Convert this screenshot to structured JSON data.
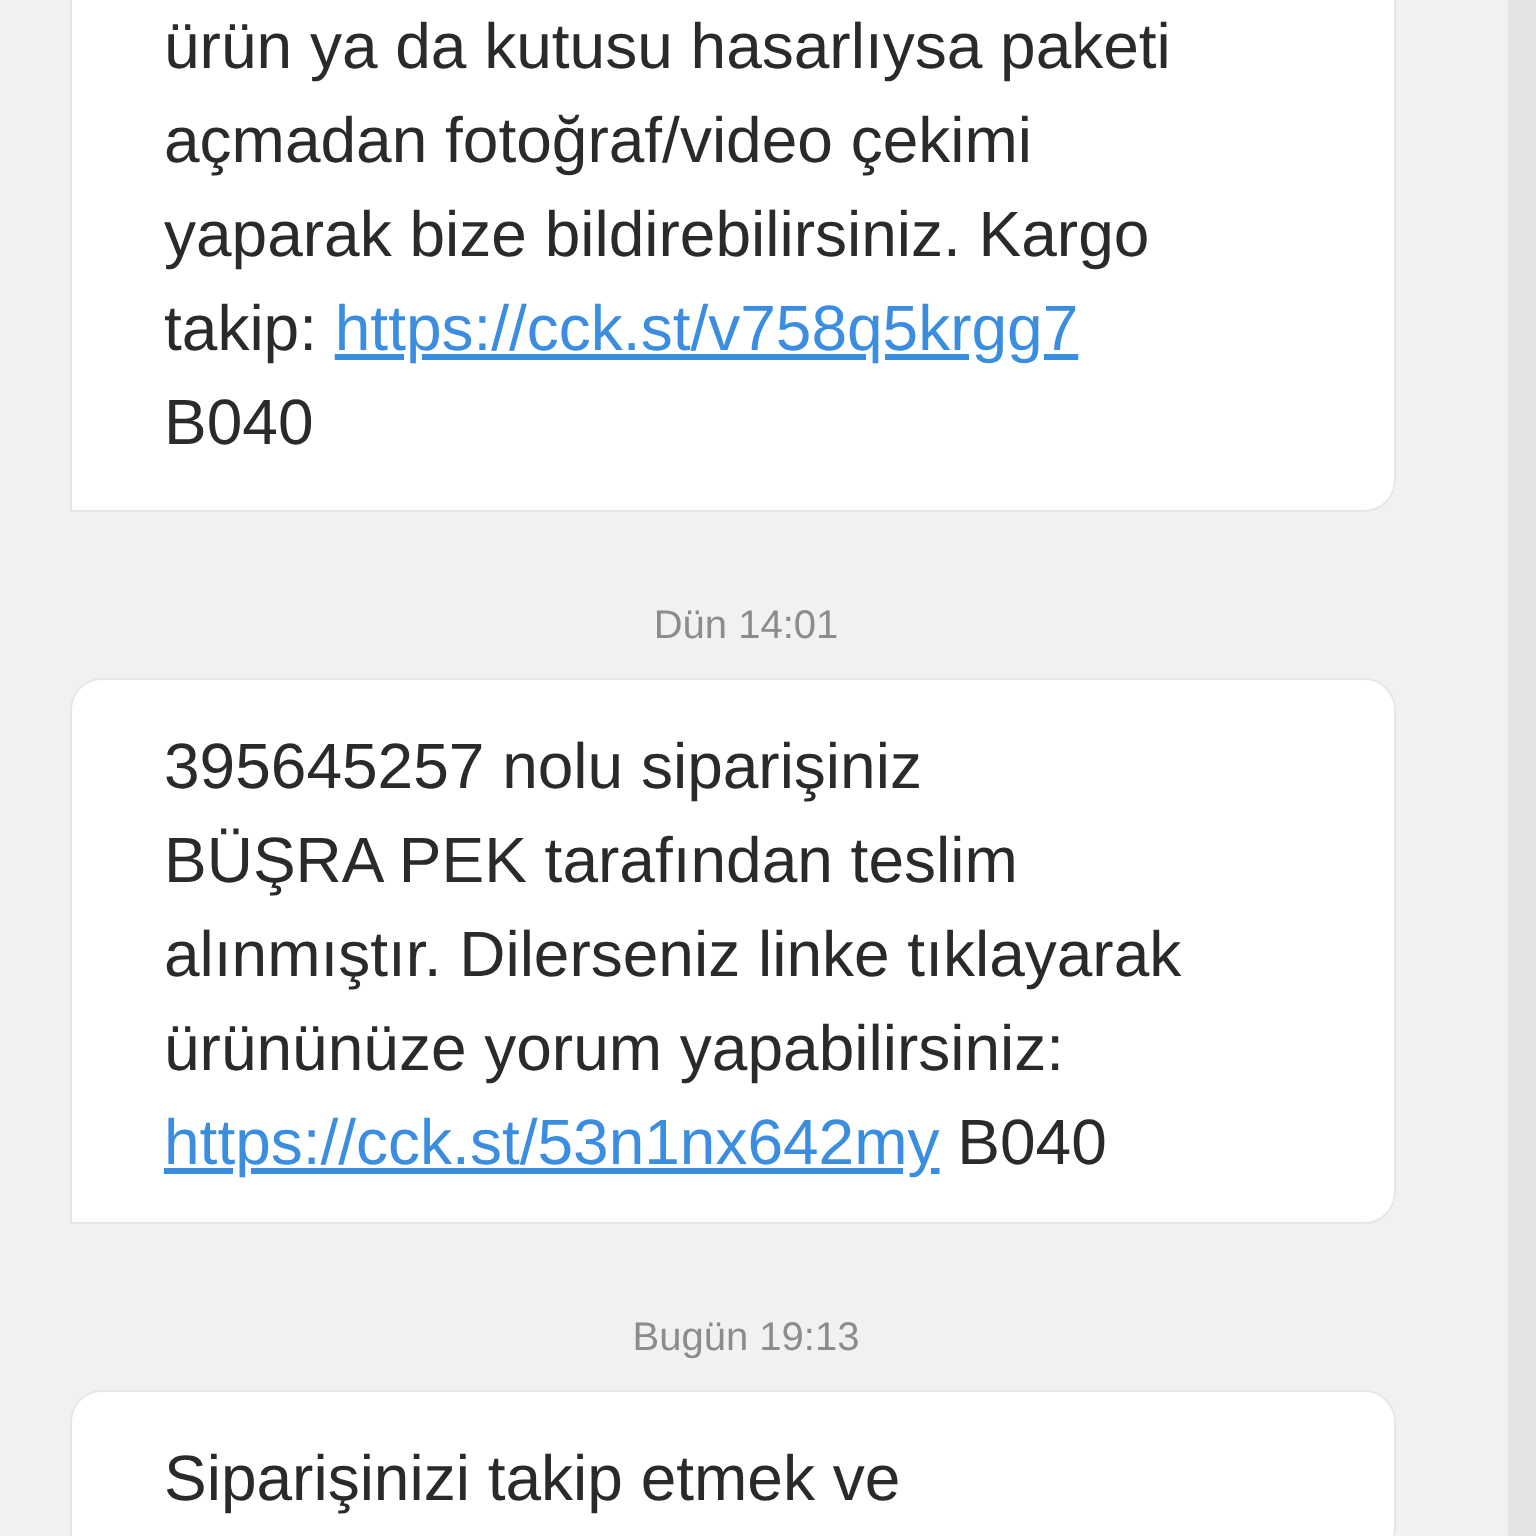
{
  "messages": [
    {
      "lines": [
        [
          {
            "kind": "text",
            "text": "ürün ya da kutusu hasarlıysa paketi"
          }
        ],
        [
          {
            "kind": "text",
            "text": "açmadan fotoğraf/video çekimi"
          }
        ],
        [
          {
            "kind": "text",
            "text": "yaparak bize bildirebilirsiniz. Kargo"
          }
        ],
        [
          {
            "kind": "text",
            "text": "takip: "
          },
          {
            "kind": "link",
            "text": "https://cck.st/v758q5krgg7"
          }
        ],
        [
          {
            "kind": "text",
            "text": "B040"
          }
        ]
      ]
    },
    {
      "timestamp": "Dün 14:01",
      "lines": [
        [
          {
            "kind": "text",
            "text": "395645257 nolu siparişiniz"
          }
        ],
        [
          {
            "kind": "text",
            "text": "BÜŞRA PEK tarafından teslim"
          }
        ],
        [
          {
            "kind": "text",
            "text": "alınmıştır. Dilerseniz linke tıklayarak"
          }
        ],
        [
          {
            "kind": "text",
            "text": "ürününüze yorum yapabilirsiniz:"
          }
        ],
        [
          {
            "kind": "link",
            "text": "https://cck.st/53n1nx642my"
          },
          {
            "kind": "text",
            "text": " B040"
          }
        ]
      ]
    },
    {
      "timestamp": "Bugün 19:13",
      "lines": [
        [
          {
            "kind": "text",
            "text": "Siparişinizi takip etmek ve"
          }
        ]
      ]
    }
  ]
}
